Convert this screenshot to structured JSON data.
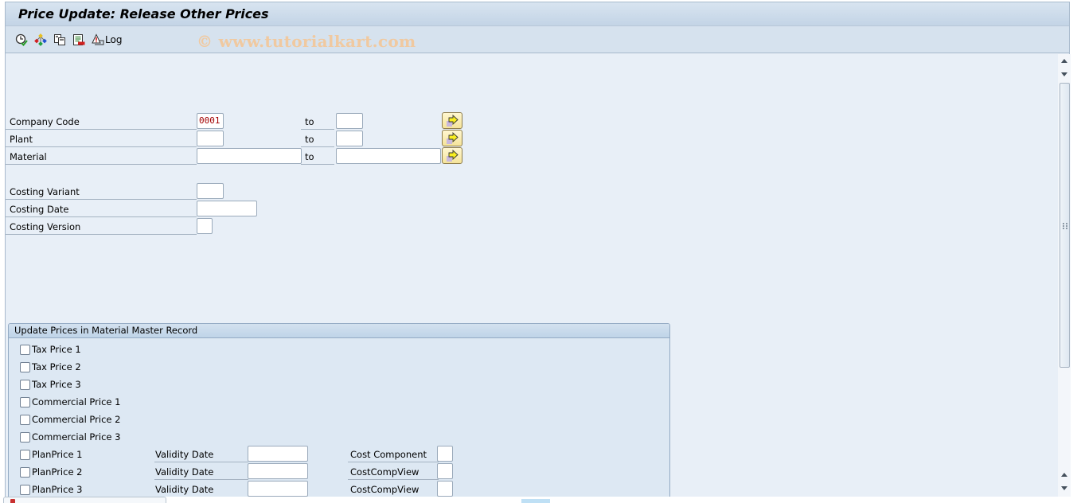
{
  "window": {
    "title": "Price Update: Release Other Prices"
  },
  "toolbar": {
    "buttons": [
      {
        "name": "execute",
        "icon": "clock-check-icon"
      },
      {
        "name": "variants",
        "icon": "hierarchy-icon"
      },
      {
        "name": "get-variant",
        "icon": "copy-pages-icon"
      },
      {
        "name": "selection-screen",
        "icon": "list-delete-icon"
      },
      {
        "name": "log",
        "icon": "warning-log-icon",
        "label": "Log"
      }
    ],
    "watermark": "© www.tutorialkart.com"
  },
  "selection": {
    "company_code": {
      "label": "Company Code",
      "from": "0001",
      "to_label": "to",
      "to": ""
    },
    "plant": {
      "label": "Plant",
      "from": "",
      "to_label": "to",
      "to": ""
    },
    "material": {
      "label": "Material",
      "from": "",
      "to_label": "to",
      "to": ""
    },
    "costing_variant": {
      "label": "Costing Variant",
      "value": ""
    },
    "costing_date": {
      "label": "Costing Date",
      "value": ""
    },
    "costing_version": {
      "label": "Costing Version",
      "value": ""
    }
  },
  "group": {
    "title": "Update Prices in Material Master Record",
    "checkboxes": [
      {
        "label": "Tax Price 1",
        "checked": false
      },
      {
        "label": "Tax Price 2",
        "checked": false
      },
      {
        "label": "Tax Price 3",
        "checked": false
      },
      {
        "label": "Commercial Price 1",
        "checked": false
      },
      {
        "label": "Commercial Price 2",
        "checked": false
      },
      {
        "label": "Commercial Price 3",
        "checked": false
      },
      {
        "label": "PlanPrice 1",
        "checked": false
      },
      {
        "label": "PlanPrice 2",
        "checked": false
      },
      {
        "label": "PlanPrice 3",
        "checked": false
      }
    ],
    "plan_rows": [
      {
        "validity_label": "Validity Date",
        "validity_value": "",
        "comp_label": "Cost Component",
        "comp_value": ""
      },
      {
        "validity_label": "Validity Date",
        "validity_value": "",
        "comp_label": "CostCompView",
        "comp_value": ""
      },
      {
        "validity_label": "Validity Date",
        "validity_value": "",
        "comp_label": "CostCompView",
        "comp_value": ""
      }
    ]
  }
}
